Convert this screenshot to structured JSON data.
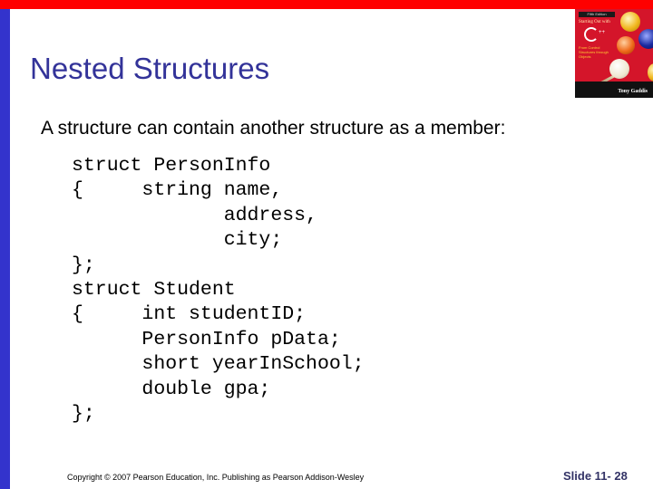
{
  "slide": {
    "title": "Nested Structures",
    "intro": "A structure can contain another structure as a member:",
    "code_lines": [
      "struct PersonInfo",
      "{     string name,",
      "             address,",
      "             city;",
      "};",
      "struct Student",
      "{     int studentID;",
      "      PersonInfo pData;",
      "      short yearInSchool;",
      "      double gpa;",
      "};"
    ],
    "footer": {
      "copyright": "Copyright © 2007 Pearson Education, Inc. Publishing as Pearson Addison-Wesley",
      "slide_number": "Slide 11- 28"
    }
  },
  "book_cover": {
    "edition": "Fifth Edition",
    "title": "Starting Out with",
    "language": "C++",
    "subtitle": "From Control Structures through Objects",
    "author": "Tony Gaddis"
  },
  "colors": {
    "top_bar": "#ff0000",
    "left_bar": "#3333cc",
    "title": "#333399",
    "slide_number": "#333366"
  }
}
